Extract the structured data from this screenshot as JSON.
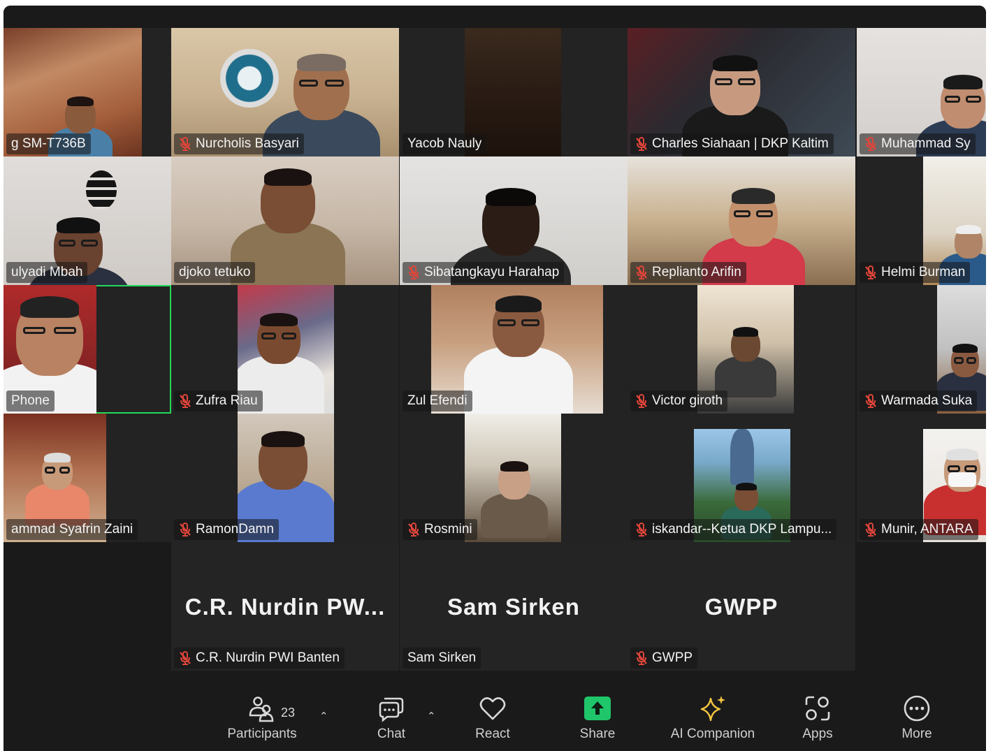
{
  "participants": [
    {
      "name": "g SM-T736B",
      "muted": false
    },
    {
      "name": "Nurcholis Basyari",
      "muted": true
    },
    {
      "name": "Yacob Nauly",
      "muted": false
    },
    {
      "name": "Charles Siahaan | DKP Kaltim",
      "muted": true
    },
    {
      "name": "Muhammad Sy",
      "muted": true
    },
    {
      "name": "ulyadi Mbah",
      "muted": false
    },
    {
      "name": "djoko tetuko",
      "muted": false
    },
    {
      "name": "Sibatangkayu Harahap",
      "muted": true
    },
    {
      "name": "Replianto Arifin",
      "muted": true
    },
    {
      "name": "Helmi Burman",
      "muted": true
    },
    {
      "name": "Phone",
      "muted": false
    },
    {
      "name": "Zufra Riau",
      "muted": true
    },
    {
      "name": "Zul Efendi",
      "muted": false
    },
    {
      "name": "Victor giroth",
      "muted": true
    },
    {
      "name": "Warmada Suka",
      "muted": true
    },
    {
      "name": "ammad Syafrin Zaini",
      "muted": false
    },
    {
      "name": "RamonDamn",
      "muted": true
    },
    {
      "name": "Rosmini",
      "muted": true
    },
    {
      "name": "iskandar--Ketua DKP Lampu...",
      "muted": true
    },
    {
      "name": "Munir, ANTARA",
      "muted": true
    },
    {
      "name": "C.R. Nurdin PWI Banten",
      "muted": true,
      "display": "C.R. Nurdin PW..."
    },
    {
      "name": "Sam Sirken",
      "muted": false,
      "display": "Sam Sirken"
    },
    {
      "name": "GWPP",
      "muted": true,
      "display": "GWPP"
    }
  ],
  "toolbar": {
    "participants_label": "Participants",
    "participants_count": "23",
    "chat_label": "Chat",
    "react_label": "React",
    "share_label": "Share",
    "ai_label": "AI Companion",
    "apps_label": "Apps",
    "more_label": "More"
  },
  "colors": {
    "background": "#1a1a1a",
    "active_speaker": "#23d959",
    "share": "#1fc66a",
    "mic_off": "#e0453a",
    "ai_companion": "#f4c542"
  }
}
